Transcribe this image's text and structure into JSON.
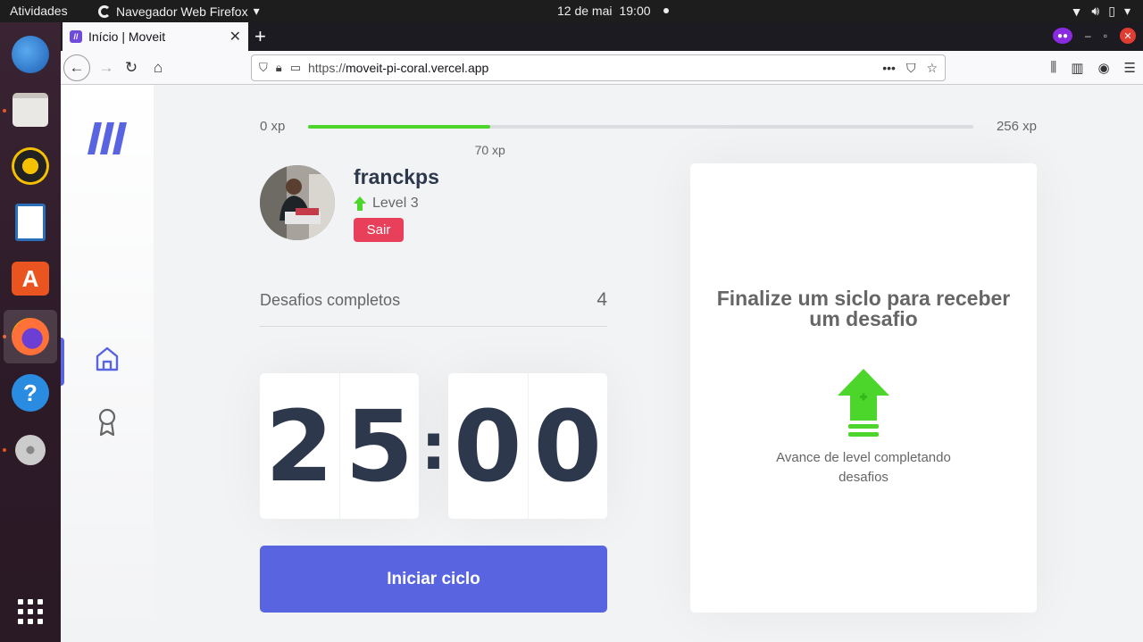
{
  "system": {
    "activities": "Atividades",
    "app_menu": "Navegador Web Firefox",
    "date": "12 de mai",
    "time": "19:00"
  },
  "browser": {
    "tab_title": "Início | Moveit",
    "url_scheme": "https://",
    "url_host": "moveit-pi-coral.vercel.app"
  },
  "xp": {
    "min_label": "0 xp",
    "max_label": "256 xp",
    "current_label": "70 xp",
    "current": 70,
    "max": 256
  },
  "profile": {
    "name": "franckps",
    "level_label": "Level 3",
    "logout_label": "Sair"
  },
  "completed": {
    "label": "Desafios completos",
    "count": "4"
  },
  "countdown": {
    "min_left": "2",
    "min_right": "5",
    "separator": ":",
    "sec_left": "0",
    "sec_right": "0"
  },
  "start_button": "Iniciar ciclo",
  "challenge": {
    "title": "Finalize um siclo para receber um desafio",
    "hint": "Avance de level completando desafios"
  },
  "colors": {
    "accent": "#5965e0",
    "xp_green": "#4cd62b",
    "logout_red": "#e83f5b"
  }
}
